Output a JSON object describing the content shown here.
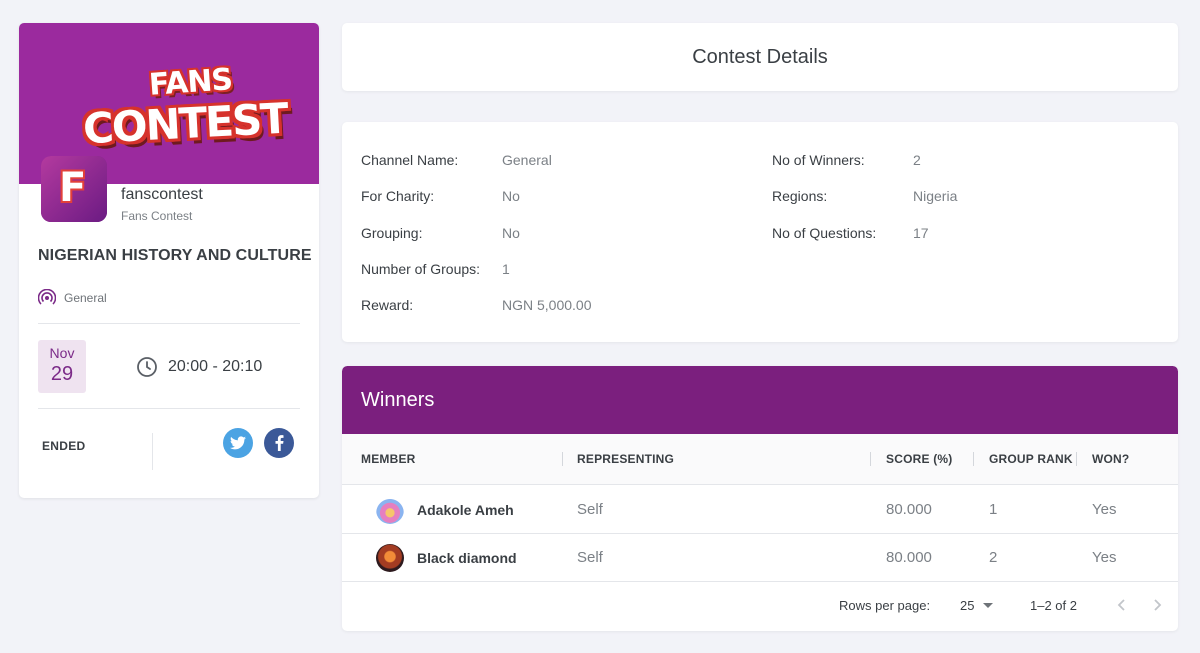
{
  "sidebar": {
    "banner_logo_line1": "FANS",
    "banner_logo_line2": "CONTEST",
    "avatar_letter": "F",
    "handle": "fanscontest",
    "handle_subtitle": "Fans Contest",
    "contest_title": "NIGERIAN HISTORY AND CULTURE",
    "channel": "General",
    "date_month": "Nov",
    "date_day": "29",
    "time_range": "20:00 - 20:10",
    "status": "ENDED",
    "social": [
      "twitter-icon",
      "facebook-icon"
    ]
  },
  "header": {
    "title": "Contest Details"
  },
  "details": {
    "left": [
      {
        "label": "Channel Name:",
        "value": "General"
      },
      {
        "label": "For Charity:",
        "value": "No"
      },
      {
        "label": "Grouping:",
        "value": "No"
      },
      {
        "label": "Number of Groups:",
        "value": "1"
      },
      {
        "label": "Reward:",
        "value": "NGN 5,000.00"
      }
    ],
    "right": [
      {
        "label": "No of Winners:",
        "value": "2"
      },
      {
        "label": "Regions:",
        "value": "Nigeria"
      },
      {
        "label": "No of Questions:",
        "value": "17"
      }
    ]
  },
  "winners": {
    "title": "Winners",
    "columns": [
      "MEMBER",
      "REPRESENTING",
      "SCORE (%)",
      "GROUP RANK",
      "WON?"
    ],
    "rows": [
      {
        "member": "Adakole Ameh",
        "representing": "Self",
        "score": "80.000",
        "rank": "1",
        "won": "Yes"
      },
      {
        "member": "Black diamond",
        "representing": "Self",
        "score": "80.000",
        "rank": "2",
        "won": "Yes"
      }
    ],
    "footer": {
      "rows_per_page_label": "Rows per page:",
      "rows_per_page_value": "25",
      "range": "1–2 of 2"
    }
  },
  "colors": {
    "brand_purple": "#7b1f7e",
    "banner_purple": "#9b2a9e",
    "twitter_blue": "#4ba3e3",
    "facebook_blue": "#3b5998"
  }
}
